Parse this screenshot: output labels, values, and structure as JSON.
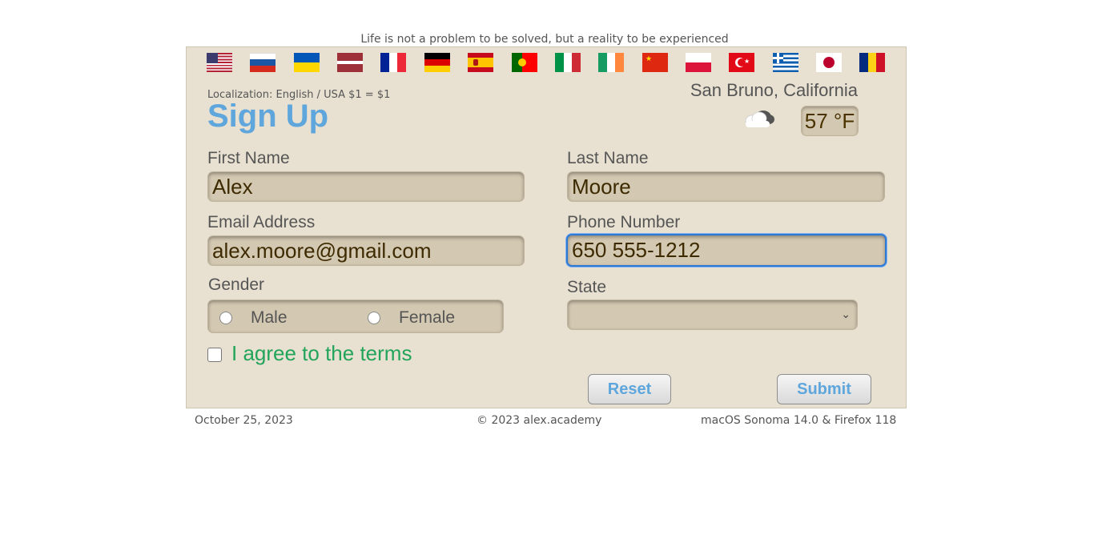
{
  "quote": "Life is not a problem to be solved, but a reality to be experienced",
  "flags": [
    {
      "name": "flag-usa-icon"
    },
    {
      "name": "flag-russia-icon"
    },
    {
      "name": "flag-ukraine-icon"
    },
    {
      "name": "flag-latvia-icon"
    },
    {
      "name": "flag-france-icon"
    },
    {
      "name": "flag-germany-icon"
    },
    {
      "name": "flag-spain-icon"
    },
    {
      "name": "flag-portugal-icon"
    },
    {
      "name": "flag-italy-icon"
    },
    {
      "name": "flag-ireland-icon"
    },
    {
      "name": "flag-china-icon"
    },
    {
      "name": "flag-poland-icon"
    },
    {
      "name": "flag-turkey-icon"
    },
    {
      "name": "flag-greece-icon"
    },
    {
      "name": "flag-japan-icon"
    },
    {
      "name": "flag-romania-icon"
    }
  ],
  "header": {
    "localization": "Localization: English / USA  $1 = $1",
    "title": "Sign Up",
    "city": "San Bruno, California",
    "weather_icon": "cloud-icon",
    "temperature": "57 °F"
  },
  "form": {
    "first_name_label": "First Name",
    "first_name_value": "Alex",
    "last_name_label": "Last Name",
    "last_name_value": "Moore",
    "email_label": "Email Address",
    "email_value": "alex.moore@gmail.com",
    "phone_label": "Phone Number",
    "phone_value": "650 555-1212",
    "gender_label": "Gender",
    "gender_male": "Male",
    "gender_female": "Female",
    "state_label": "State",
    "state_value": "",
    "agree_label": "I agree to the terms",
    "reset_label": "Reset",
    "submit_label": "Submit"
  },
  "footer": {
    "date": "October 25, 2023",
    "copyright": "© 2023 alex.academy",
    "platform": "macOS Sonoma 14.0 & Firefox 118"
  },
  "colors": {
    "panel_bg": "#e8e1d1",
    "field_bg": "#d3c8b1",
    "title_blue": "#5ea6dc",
    "agree_green": "#22a45b",
    "focus_blue": "#2f79d6"
  }
}
